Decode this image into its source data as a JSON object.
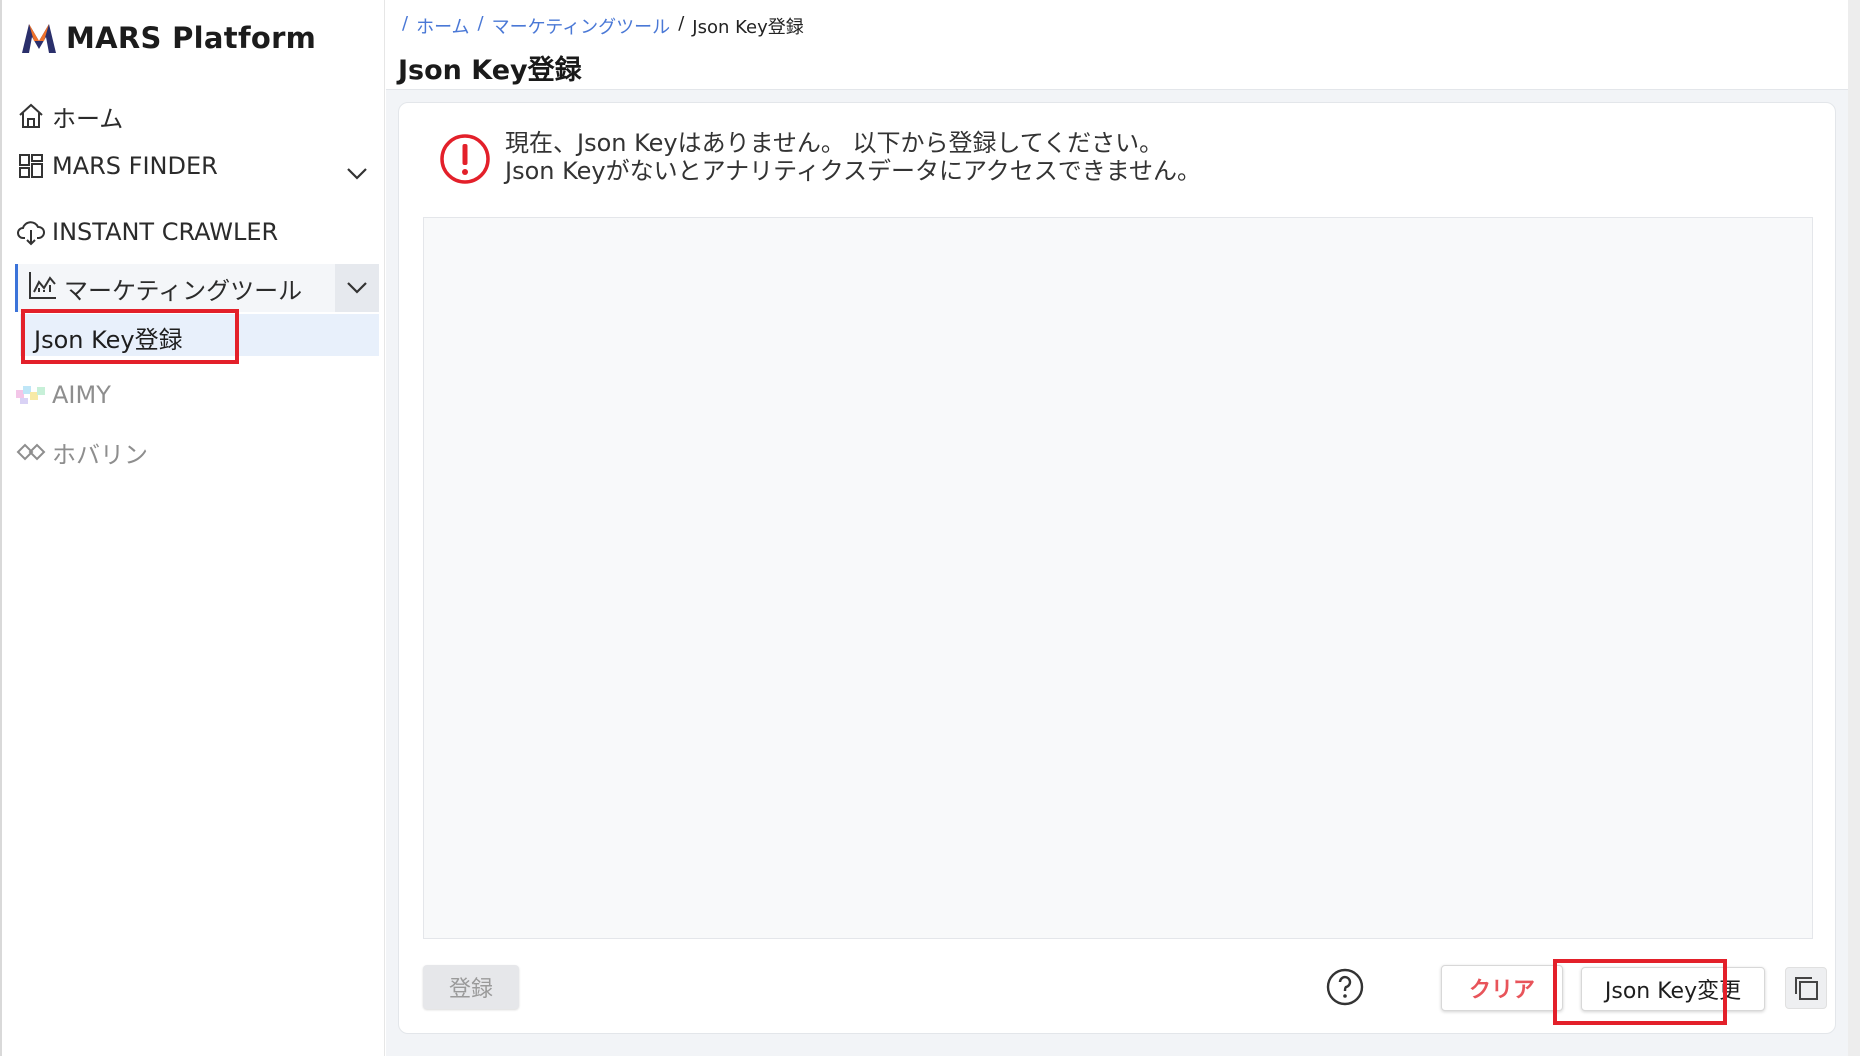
{
  "app": {
    "logo_text": "MARS Platform"
  },
  "sidebar": {
    "home": "ホーム",
    "mars_finder": "MARS FINDER",
    "instant_crawler": "INSTANT CRAWLER",
    "marketing_tools": "マーケティングツール",
    "json_key_register": "Json Key登録",
    "aimy": "AIMY",
    "hobarin": "ホバリン"
  },
  "breadcrumb": {
    "sep": "/",
    "home": "ホーム",
    "marketing": "マーケティングツール",
    "current": "Json Key登録"
  },
  "page": {
    "title": "Json Key登録"
  },
  "alert": {
    "line1": "現在、Json Keyはありません。 以下から登録してください。",
    "line2": "Json Keyがないとアナリティクスデータにアクセスできません。"
  },
  "editor": {
    "value": ""
  },
  "actions": {
    "register": "登録",
    "clear": "クリア",
    "change_key": "Json Key変更"
  },
  "colors": {
    "accent": "#3b73d9",
    "highlight": "#e3202a",
    "danger_text": "#e8545a"
  }
}
